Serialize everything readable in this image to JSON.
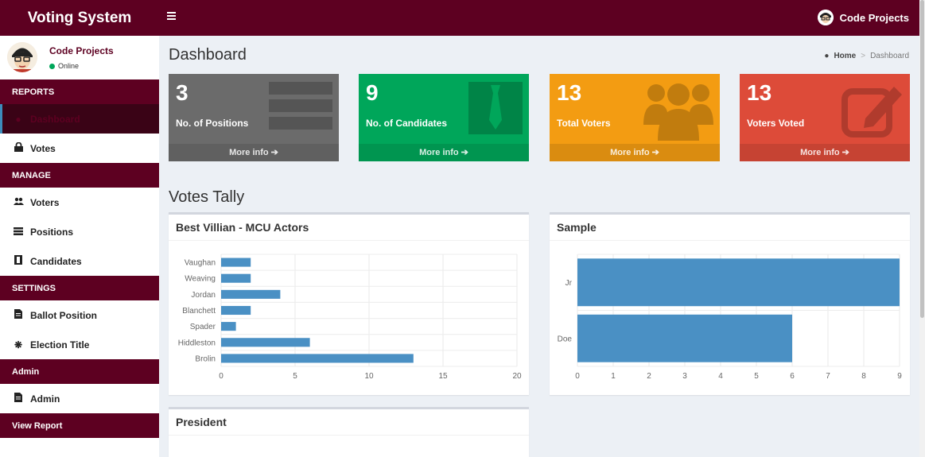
{
  "app": {
    "title": "Voting System",
    "user_name": "Code Projects"
  },
  "sidebar": {
    "user_name": "Code Projects",
    "status": "Online",
    "sections": {
      "reports": "REPORTS",
      "manage": "MANAGE",
      "settings": "SETTINGS",
      "admin": "Admin",
      "view_report": "View Report"
    },
    "items": {
      "dashboard": "Dashboard",
      "votes": "Votes",
      "voters": "Voters",
      "positions": "Positions",
      "candidates": "Candidates",
      "ballot_position": "Ballot Position",
      "election_title": "Election Title",
      "admin": "Admin"
    }
  },
  "header": {
    "page_title": "Dashboard",
    "breadcrumb_home": "Home",
    "breadcrumb_sep": ">",
    "breadcrumb_current": "Dashboard"
  },
  "stats": [
    {
      "number": "3",
      "label": "No. of Positions",
      "more": "More info ➔",
      "color": "#6b6b6b"
    },
    {
      "number": "9",
      "label": "No. of Candidates",
      "more": "More info ➔",
      "color": "#00a65a"
    },
    {
      "number": "13",
      "label": "Total Voters",
      "more": "More info ➔",
      "color": "#f39c12"
    },
    {
      "number": "13",
      "label": "Voters Voted",
      "more": "More info ➔",
      "color": "#dd4b39"
    }
  ],
  "tally_title": "Votes Tally",
  "chart_data": [
    {
      "type": "bar",
      "orientation": "horizontal",
      "title": "Best Villian - MCU Actors",
      "categories": [
        "Vaughan",
        "Weaving",
        "Jordan",
        "Blanchett",
        "Spader",
        "Hiddleston",
        "Brolin"
      ],
      "values": [
        2,
        2,
        4,
        2,
        1,
        6,
        13
      ],
      "xlim": [
        0,
        20
      ],
      "xticks": [
        0,
        5,
        10,
        15,
        20
      ],
      "color": "#4a90c4"
    },
    {
      "type": "bar",
      "orientation": "horizontal",
      "title": "Sample",
      "categories": [
        "Jr",
        "Doe"
      ],
      "values": [
        9,
        6
      ],
      "xlim": [
        0,
        9
      ],
      "xticks": [
        0,
        1,
        2,
        3,
        4,
        5,
        6,
        7,
        8,
        9
      ],
      "color": "#4a90c4"
    }
  ],
  "president_title": "President"
}
